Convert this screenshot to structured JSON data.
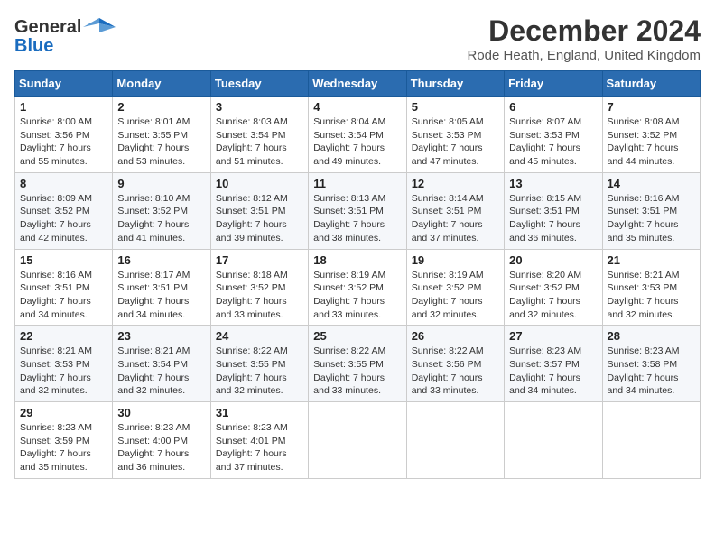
{
  "header": {
    "logo_line1": "General",
    "logo_line2": "Blue",
    "title": "December 2024",
    "subtitle": "Rode Heath, England, United Kingdom"
  },
  "calendar": {
    "days_of_week": [
      "Sunday",
      "Monday",
      "Tuesday",
      "Wednesday",
      "Thursday",
      "Friday",
      "Saturday"
    ],
    "weeks": [
      [
        {
          "day": "",
          "detail": ""
        },
        {
          "day": "2",
          "detail": "Sunrise: 8:01 AM\nSunset: 3:55 PM\nDaylight: 7 hours\nand 53 minutes."
        },
        {
          "day": "3",
          "detail": "Sunrise: 8:03 AM\nSunset: 3:54 PM\nDaylight: 7 hours\nand 51 minutes."
        },
        {
          "day": "4",
          "detail": "Sunrise: 8:04 AM\nSunset: 3:54 PM\nDaylight: 7 hours\nand 49 minutes."
        },
        {
          "day": "5",
          "detail": "Sunrise: 8:05 AM\nSunset: 3:53 PM\nDaylight: 7 hours\nand 47 minutes."
        },
        {
          "day": "6",
          "detail": "Sunrise: 8:07 AM\nSunset: 3:53 PM\nDaylight: 7 hours\nand 45 minutes."
        },
        {
          "day": "7",
          "detail": "Sunrise: 8:08 AM\nSunset: 3:52 PM\nDaylight: 7 hours\nand 44 minutes."
        }
      ],
      [
        {
          "day": "1",
          "detail": "Sunrise: 8:00 AM\nSunset: 3:56 PM\nDaylight: 7 hours\nand 55 minutes."
        },
        {
          "day": "9",
          "detail": "Sunrise: 8:10 AM\nSunset: 3:52 PM\nDaylight: 7 hours\nand 41 minutes."
        },
        {
          "day": "10",
          "detail": "Sunrise: 8:12 AM\nSunset: 3:51 PM\nDaylight: 7 hours\nand 39 minutes."
        },
        {
          "day": "11",
          "detail": "Sunrise: 8:13 AM\nSunset: 3:51 PM\nDaylight: 7 hours\nand 38 minutes."
        },
        {
          "day": "12",
          "detail": "Sunrise: 8:14 AM\nSunset: 3:51 PM\nDaylight: 7 hours\nand 37 minutes."
        },
        {
          "day": "13",
          "detail": "Sunrise: 8:15 AM\nSunset: 3:51 PM\nDaylight: 7 hours\nand 36 minutes."
        },
        {
          "day": "14",
          "detail": "Sunrise: 8:16 AM\nSunset: 3:51 PM\nDaylight: 7 hours\nand 35 minutes."
        }
      ],
      [
        {
          "day": "8",
          "detail": "Sunrise: 8:09 AM\nSunset: 3:52 PM\nDaylight: 7 hours\nand 42 minutes."
        },
        {
          "day": "16",
          "detail": "Sunrise: 8:17 AM\nSunset: 3:51 PM\nDaylight: 7 hours\nand 34 minutes."
        },
        {
          "day": "17",
          "detail": "Sunrise: 8:18 AM\nSunset: 3:52 PM\nDaylight: 7 hours\nand 33 minutes."
        },
        {
          "day": "18",
          "detail": "Sunrise: 8:19 AM\nSunset: 3:52 PM\nDaylight: 7 hours\nand 33 minutes."
        },
        {
          "day": "19",
          "detail": "Sunrise: 8:19 AM\nSunset: 3:52 PM\nDaylight: 7 hours\nand 32 minutes."
        },
        {
          "day": "20",
          "detail": "Sunrise: 8:20 AM\nSunset: 3:52 PM\nDaylight: 7 hours\nand 32 minutes."
        },
        {
          "day": "21",
          "detail": "Sunrise: 8:21 AM\nSunset: 3:53 PM\nDaylight: 7 hours\nand 32 minutes."
        }
      ],
      [
        {
          "day": "15",
          "detail": "Sunrise: 8:16 AM\nSunset: 3:51 PM\nDaylight: 7 hours\nand 34 minutes."
        },
        {
          "day": "23",
          "detail": "Sunrise: 8:21 AM\nSunset: 3:54 PM\nDaylight: 7 hours\nand 32 minutes."
        },
        {
          "day": "24",
          "detail": "Sunrise: 8:22 AM\nSunset: 3:55 PM\nDaylight: 7 hours\nand 32 minutes."
        },
        {
          "day": "25",
          "detail": "Sunrise: 8:22 AM\nSunset: 3:55 PM\nDaylight: 7 hours\nand 33 minutes."
        },
        {
          "day": "26",
          "detail": "Sunrise: 8:22 AM\nSunset: 3:56 PM\nDaylight: 7 hours\nand 33 minutes."
        },
        {
          "day": "27",
          "detail": "Sunrise: 8:23 AM\nSunset: 3:57 PM\nDaylight: 7 hours\nand 34 minutes."
        },
        {
          "day": "28",
          "detail": "Sunrise: 8:23 AM\nSunset: 3:58 PM\nDaylight: 7 hours\nand 34 minutes."
        }
      ],
      [
        {
          "day": "22",
          "detail": "Sunrise: 8:21 AM\nSunset: 3:53 PM\nDaylight: 7 hours\nand 32 minutes."
        },
        {
          "day": "30",
          "detail": "Sunrise: 8:23 AM\nSunset: 4:00 PM\nDaylight: 7 hours\nand 36 minutes."
        },
        {
          "day": "31",
          "detail": "Sunrise: 8:23 AM\nSunset: 4:01 PM\nDaylight: 7 hours\nand 37 minutes."
        },
        {
          "day": "",
          "detail": ""
        },
        {
          "day": "",
          "detail": ""
        },
        {
          "day": "",
          "detail": ""
        },
        {
          "day": ""
        }
      ],
      [
        {
          "day": "29",
          "detail": "Sunrise: 8:23 AM\nSunset: 3:59 PM\nDaylight: 7 hours\nand 35 minutes."
        },
        {
          "day": "",
          "detail": ""
        },
        {
          "day": "",
          "detail": ""
        },
        {
          "day": "",
          "detail": ""
        },
        {
          "day": "",
          "detail": ""
        },
        {
          "day": "",
          "detail": ""
        },
        {
          "day": "",
          "detail": ""
        }
      ]
    ]
  }
}
